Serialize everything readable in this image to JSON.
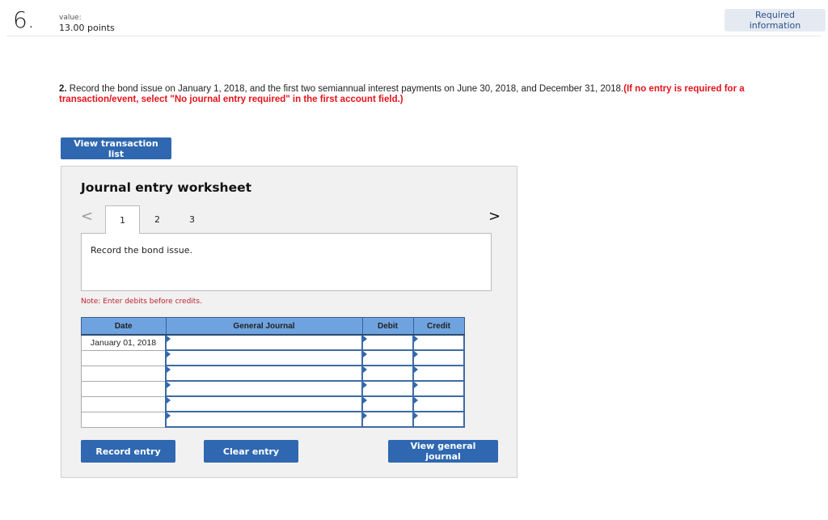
{
  "question": {
    "number": "6.",
    "value_label": "value:",
    "points": "13.00 points",
    "required_info_button": "Required information"
  },
  "instructions": {
    "number": "2.",
    "text": " Record the bond issue on January 1, 2018, and the first two semiannual interest payments on June 30, 2018, and December 31, 2018.",
    "red_text": "(If no entry is required for a transaction/event, select \"No journal entry required\" in the first account field.)"
  },
  "view_transaction_list": "View transaction list",
  "worksheet": {
    "title": "Journal entry worksheet",
    "prev_icon": "<",
    "next_icon": ">",
    "tabs": [
      "1",
      "2",
      "3"
    ],
    "active_tab": "1",
    "description": "Record the bond issue.",
    "note": "Note: Enter debits before credits.",
    "table": {
      "headers": [
        "Date",
        "General Journal",
        "Debit",
        "Credit"
      ],
      "rows": [
        {
          "date": "January 01, 2018",
          "account": "",
          "debit": "",
          "credit": ""
        },
        {
          "date": "",
          "account": "",
          "debit": "",
          "credit": ""
        },
        {
          "date": "",
          "account": "",
          "debit": "",
          "credit": ""
        },
        {
          "date": "",
          "account": "",
          "debit": "",
          "credit": ""
        },
        {
          "date": "",
          "account": "",
          "debit": "",
          "credit": ""
        },
        {
          "date": "",
          "account": "",
          "debit": "",
          "credit": ""
        }
      ]
    },
    "buttons": {
      "record": "Record entry",
      "clear": "Clear entry",
      "view_general_journal": "View general journal"
    }
  },
  "colors": {
    "button_blue": "#2f68b0",
    "header_blue": "#6ea3e0",
    "alert_red": "#e4131a",
    "note_red": "#c0202a"
  }
}
